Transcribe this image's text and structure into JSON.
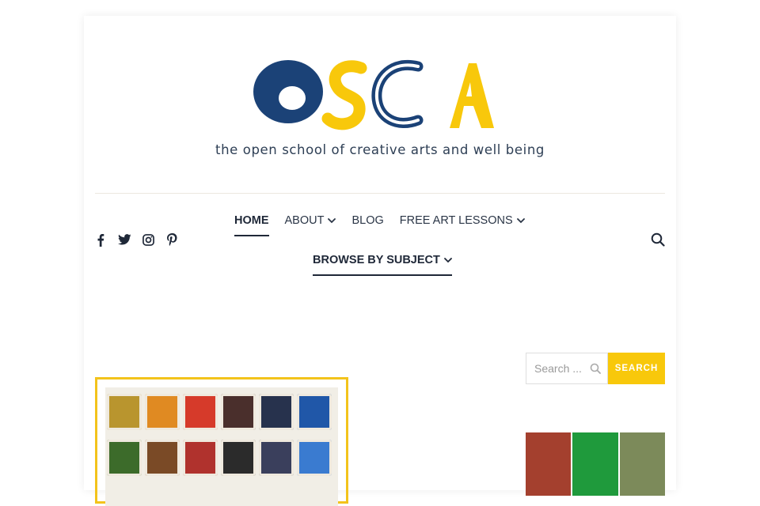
{
  "logo": {
    "letters": [
      "O",
      "S",
      "C",
      "A"
    ],
    "tagline": "the open school of creative arts and well being",
    "colors": {
      "navy": "#1b4277",
      "yellow": "#f8c80b"
    }
  },
  "social": [
    {
      "name": "facebook-icon"
    },
    {
      "name": "twitter-icon"
    },
    {
      "name": "instagram-icon"
    },
    {
      "name": "pinterest-icon"
    }
  ],
  "nav": {
    "items": [
      {
        "label": "HOME",
        "active": true
      },
      {
        "label": "ABOUT",
        "dropdown": true
      },
      {
        "label": "BLOG"
      },
      {
        "label": "FREE ART LESSONS",
        "dropdown": true
      },
      {
        "label": "BROWSE BY SUBJECT",
        "dropdown": true,
        "active": true
      }
    ]
  },
  "header_search": {
    "icon": "search-icon"
  },
  "sidebar": {
    "search": {
      "placeholder": "Search ...",
      "button_label": "SEARCH"
    }
  },
  "colors": {
    "accent": "#f8c80b",
    "text": "#1f2838",
    "divider": "#ece8df"
  }
}
